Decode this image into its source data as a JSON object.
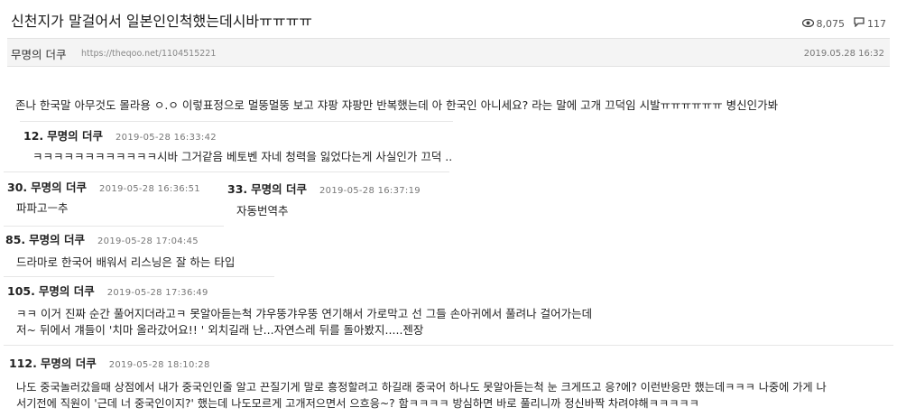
{
  "post": {
    "title": "신천지가 말걸어서 일본인인척했는데시바ㅠㅠㅠㅠ",
    "views": "8,075",
    "comments": "117",
    "author": "무명의 더쿠",
    "url": "https://theqoo.net/1104515221",
    "date": "2019.05.28 16:32",
    "body": "존나 한국말 아무것도 몰라용 ㅇ.ㅇ 이렇표정으로 멀뚱멀뚱 보고 쟈팡 쟈팡만 반복했는데 아 한국인 아니세요? 라는 말에 고개 끄덕임 시발ㅠㅠㅠㅠㅠㅠ 병신인가봐",
    "view_icon": "eye-icon",
    "comment_icon": "speech-bubble-icon"
  },
  "comments": [
    {
      "num": "12.",
      "name": "무명의 더쿠",
      "time": "2019-05-28 16:33:42",
      "lines": [
        "ㅋㅋㅋㅋㅋㅋㅋㅋㅋㅋㅋㅋ시바 그거같음 베토벤 자네 청력을 잃었다는게 사실인가 끄덕 .."
      ]
    },
    {
      "num": "30.",
      "name": "무명의 더쿠",
      "time": "2019-05-28 16:36:51",
      "lines": [
        "파파고ㅡ추"
      ]
    },
    {
      "num": "33.",
      "name": "무명의 더쿠",
      "time": "2019-05-28 16:37:19",
      "lines": [
        "자동번역추"
      ]
    },
    {
      "num": "85.",
      "name": "무명의 더쿠",
      "time": "2019-05-28 17:04:45",
      "lines": [
        "드라마로 한국어 배워서 리스닝은 잘 하는 타입"
      ]
    },
    {
      "num": "105.",
      "name": "무명의 더쿠",
      "time": "2019-05-28 17:36:49",
      "lines": [
        "ㅋㅋ 이거 진짜 순간 풀어지더라고ㅋ 못알아듣는척 갸우뚱갸우뚱 연기해서 가로막고 선 그들 손아귀에서 풀려나 걸어가는데",
        "저~ 뒤에서 걔들이 '치마 올라갔어요!! ' 외치길래 난...자연스레 뒤를 돌아봤지.....젠장"
      ]
    },
    {
      "num": "112.",
      "name": "무명의 더쿠",
      "time": "2019-05-28 18:10:28",
      "lines": [
        "나도 중국놀러갔을때 상점에서 내가 중국인인줄 알고 끈질기게 말로 흥정할려고 하길래 중국어 하나도 못알아듣는척 눈 크게뜨고 응?에? 이런반응만 했는데ㅋㅋㅋ 나중에 가게 나",
        "서기전에 직원이 '근데 너 중국인이지?' 했는데 나도모르게 고개저으면서 으흐응~? 함ㅋㅋㅋㅋ 방심하면 바로 풀리니까 정신바짝 차려야해ㅋㅋㅋㅋㅋ"
      ]
    }
  ]
}
